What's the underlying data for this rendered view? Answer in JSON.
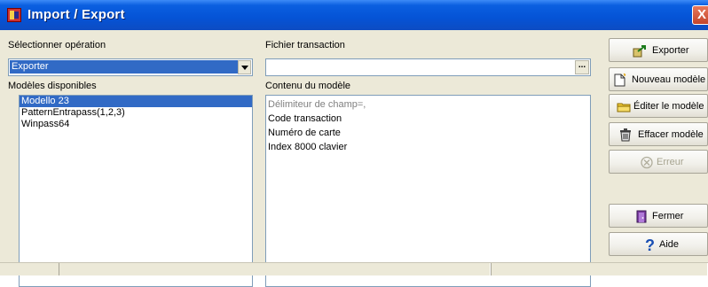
{
  "window": {
    "title": "Import / Export",
    "close_glyph": "X",
    "app_icon": "import-export-app-icon"
  },
  "operation": {
    "label": "Sélectionner opération",
    "value": "Exporter"
  },
  "transaction_file": {
    "label": "Fichier transaction",
    "value": "",
    "browse_label": "..."
  },
  "models": {
    "label": "Modèles disponibles",
    "items": [
      "Modello 23",
      "PatternEntrapass(1,2,3)",
      "Winpass64"
    ],
    "selected": "Modello 23"
  },
  "model_content": {
    "label": "Contenu du modèle",
    "items": [
      "Délimiteur de champ=,",
      "Code transaction",
      "Numéro de carte",
      "Index 8000 clavier"
    ]
  },
  "buttons": {
    "export": {
      "label": "Exporter",
      "icon": "export-icon"
    },
    "new_model": {
      "label": "Nouveau modèle",
      "icon": "new-document-icon"
    },
    "edit_model": {
      "label": "Éditer le modèle",
      "icon": "folder-edit-icon"
    },
    "delete_model": {
      "label": "Effacer modèle",
      "icon": "trash-icon"
    },
    "error": {
      "label": "Erreur",
      "icon": "error-circle-icon",
      "enabled": false
    },
    "close": {
      "label": "Fermer",
      "icon": "door-exit-icon"
    },
    "help": {
      "label": "Aide",
      "icon": "help-icon"
    }
  },
  "colors": {
    "title_bar": "#0553d6",
    "selection": "#316ac5",
    "dialog_bg": "#ece9d8"
  }
}
